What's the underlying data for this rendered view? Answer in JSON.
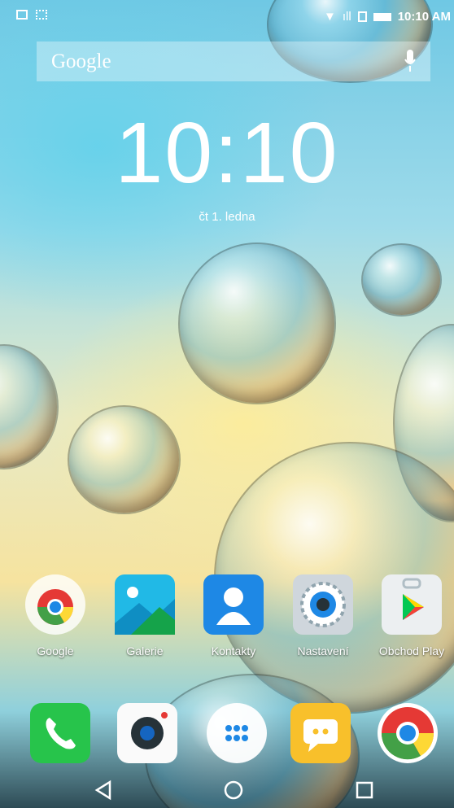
{
  "status_bar": {
    "time": "10:10 AM"
  },
  "search": {
    "brand": "Google"
  },
  "clock": {
    "time": "10:10",
    "date": "čt 1. ledna"
  },
  "apps": [
    {
      "label": "Google"
    },
    {
      "label": "Galerie"
    },
    {
      "label": "Kontakty"
    },
    {
      "label": "Nastavení"
    },
    {
      "label": "Obchod Play"
    }
  ],
  "dock": [
    {
      "icon": "phone-icon"
    },
    {
      "icon": "camera-icon"
    },
    {
      "icon": "app-drawer-icon"
    },
    {
      "icon": "messages-icon"
    },
    {
      "icon": "chrome-icon"
    }
  ],
  "navigation": {
    "back": "back-icon",
    "home": "home-icon",
    "recents": "recents-icon"
  },
  "colors": {
    "phone_green": "#27c44b",
    "messages_yellow": "#f8c02b",
    "contacts_blue": "#1e88e5",
    "gallery_blue": "#21b9e6"
  }
}
